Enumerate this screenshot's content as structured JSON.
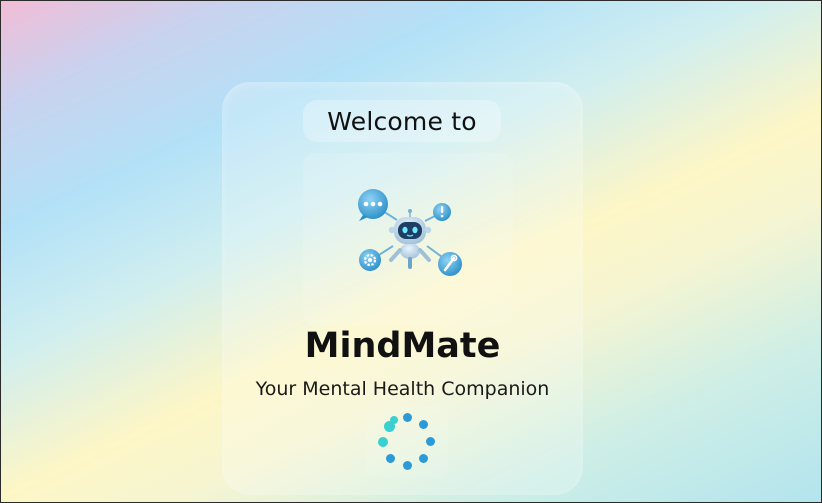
{
  "welcome": {
    "text": "Welcome to"
  },
  "app": {
    "name": "MindMate",
    "tagline": "Your Mental Health Companion"
  },
  "logo": {
    "icon": "robot-mascot-icon"
  },
  "loader": {
    "icon": "loading-spinner-icon"
  },
  "colors": {
    "accent": "#2d9ad8",
    "accent_light": "#3ad0d0",
    "text": "#111111"
  }
}
